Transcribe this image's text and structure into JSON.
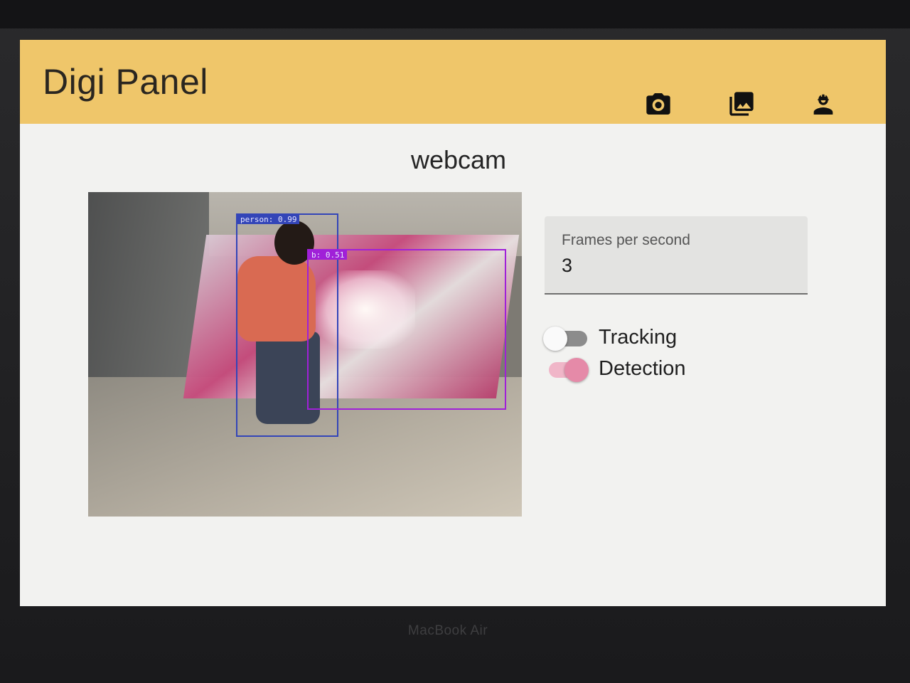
{
  "app": {
    "title": "Digi Panel",
    "accent_color": "#efc66a"
  },
  "toolbar": {
    "icons": [
      "camera-icon",
      "photo-library-icon",
      "engineer-icon"
    ]
  },
  "page": {
    "heading": "webcam"
  },
  "video": {
    "detections": [
      {
        "label": "person: 0.99",
        "color": "#3345b8"
      },
      {
        "label": "b: 0.51",
        "color": "#a020d8"
      }
    ]
  },
  "settings": {
    "fps_label": "Frames per second",
    "fps_value": "3",
    "tracking": {
      "label": "Tracking",
      "enabled": false
    },
    "detection": {
      "label": "Detection",
      "enabled": true,
      "color": "#e58aa8"
    }
  },
  "device": {
    "brand": "MacBook Air"
  }
}
